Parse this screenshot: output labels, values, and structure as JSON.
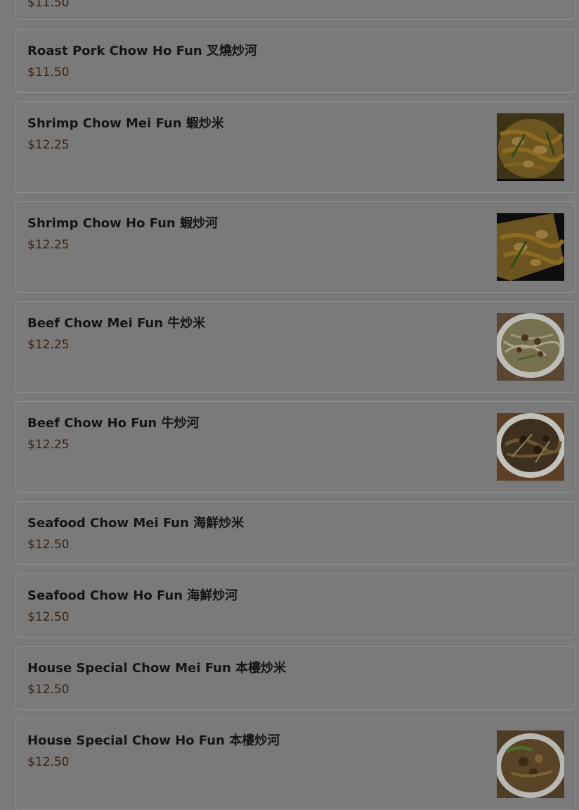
{
  "menu": {
    "items": [
      {
        "name": "",
        "price": "$11.50",
        "has_photo": false
      },
      {
        "name": "Roast Pork Chow Ho Fun 叉燒炒河",
        "price": "$11.50",
        "has_photo": false
      },
      {
        "name": "Shrimp Chow Mei Fun 蝦炒米",
        "price": "$12.25",
        "has_photo": true,
        "photo": "shrimp-noodles-photo"
      },
      {
        "name": "Shrimp Chow Ho Fun 蝦炒河",
        "price": "$12.25",
        "has_photo": true,
        "photo": "shrimp-noodles-photo"
      },
      {
        "name": "Beef Chow Mei Fun 牛炒米",
        "price": "$12.25",
        "has_photo": true,
        "photo": "beef-rice-noodles-photo"
      },
      {
        "name": "Beef Chow Ho Fun 牛炒河",
        "price": "$12.25",
        "has_photo": true,
        "photo": "beef-chow-fun-photo"
      },
      {
        "name": "Seafood Chow Mei Fun 海鮮炒米",
        "price": "$12.50",
        "has_photo": false
      },
      {
        "name": "Seafood Chow Ho Fun 海鮮炒河",
        "price": "$12.50",
        "has_photo": false
      },
      {
        "name": "House Special Chow Mei Fun 本樓炒米",
        "price": "$12.50",
        "has_photo": false
      },
      {
        "name": "House Special Chow Ho Fun 本樓炒河",
        "price": "$12.50",
        "has_photo": true,
        "photo": "house-special-photo"
      }
    ]
  }
}
